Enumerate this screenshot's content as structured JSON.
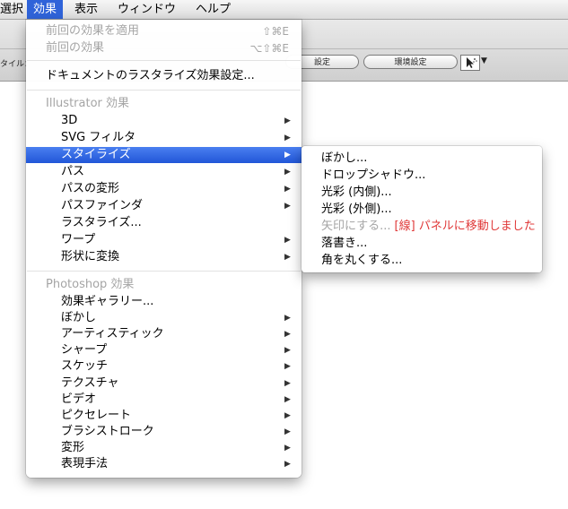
{
  "menubar": {
    "items": [
      "選択",
      "効果",
      "表示",
      "ウィンドウ",
      "ヘルプ"
    ],
    "active_index": 1
  },
  "toolbar": {
    "style_label": "タイル：",
    "pill_left": "設定",
    "pill_right": "環境設定"
  },
  "main_menu": {
    "apply_last": {
      "label": "前回の効果を適用",
      "shortcut": "⇧⌘E"
    },
    "last_effect": {
      "label": "前回の効果",
      "shortcut": "⌥⇧⌘E"
    },
    "rasterize_settings": "ドキュメントのラスタライズ効果設定...",
    "illustrator_header": "Illustrator 効果",
    "illustrator_items": [
      {
        "label": "3D",
        "submenu": true
      },
      {
        "label": "SVG フィルタ",
        "submenu": true
      },
      {
        "label": "スタイライズ",
        "submenu": true,
        "highlighted": true
      },
      {
        "label": "パス",
        "submenu": true
      },
      {
        "label": "パスの変形",
        "submenu": true
      },
      {
        "label": "パスファインダ",
        "submenu": true
      },
      {
        "label": "ラスタライズ...",
        "submenu": false
      },
      {
        "label": "ワープ",
        "submenu": true
      },
      {
        "label": "形状に変換",
        "submenu": true
      }
    ],
    "photoshop_header": "Photoshop 効果",
    "photoshop_items": [
      {
        "label": "効果ギャラリー...",
        "submenu": false
      },
      {
        "label": "ぼかし",
        "submenu": true
      },
      {
        "label": "アーティスティック",
        "submenu": true
      },
      {
        "label": "シャープ",
        "submenu": true
      },
      {
        "label": "スケッチ",
        "submenu": true
      },
      {
        "label": "テクスチャ",
        "submenu": true
      },
      {
        "label": "ビデオ",
        "submenu": true
      },
      {
        "label": "ピクセレート",
        "submenu": true
      },
      {
        "label": "ブラシストローク",
        "submenu": true
      },
      {
        "label": "変形",
        "submenu": true
      },
      {
        "label": "表現手法",
        "submenu": true
      }
    ],
    "arrow_glyph": "▶"
  },
  "sub_menu": {
    "items": [
      {
        "label": "ぼかし...",
        "disabled": false
      },
      {
        "label": "ドロップシャドウ...",
        "disabled": false
      },
      {
        "label": "光彩 (内側)...",
        "disabled": false
      },
      {
        "label": "光彩 (外側)...",
        "disabled": false
      },
      {
        "label": "矢印にする...",
        "disabled": true,
        "note": "[線] パネルに移動しました"
      },
      {
        "label": "落書き...",
        "disabled": false
      },
      {
        "label": "角を丸くする...",
        "disabled": false
      }
    ]
  },
  "colors": {
    "highlight": "#2f63d9",
    "note_red": "#e03a3a",
    "disabled_gray": "#a5a5a5"
  }
}
